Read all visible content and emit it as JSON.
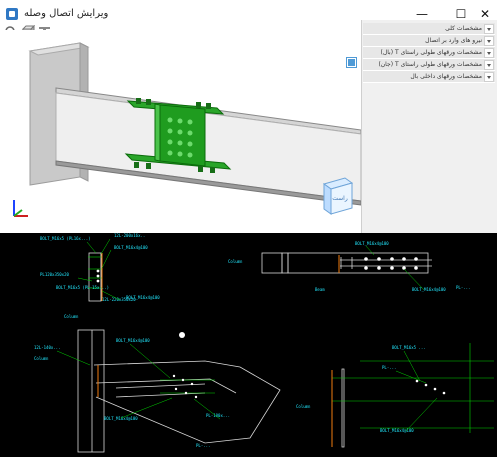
{
  "window": {
    "title": "ویرایش اتصال وصله",
    "minimize": "—",
    "maximize": "☐",
    "close": "✕"
  },
  "toolbar": {
    "zoom_icon": "magnifier-icon",
    "box_icon": "box-icon",
    "beam_icon": "beam-icon"
  },
  "right_panel": {
    "items": [
      "مشخصات کلی",
      "نیرو های وارد بر اتصال",
      "مشخصات ورقهای طولی راستای T (بال)",
      "مشخصات ورقهای طولی راستای T (جان)",
      "مشخصات ورقهای داخلی بال"
    ]
  },
  "cube": {
    "face_label": "راست"
  },
  "drawing": {
    "labels": {
      "top_left_1": "BOLT_M16x5 (PL16x...)",
      "top_left_2": "12L-200x16x..",
      "top_left_3": "BOLT_M16x4@100",
      "top_left_4": "PL120x350x20",
      "top_left_5": "BOLT_M16x5 (PL-15x...)",
      "top_left_6": "12L-220x350x20",
      "top_left_7": "BOLT_M16x4@100",
      "top_left_8": "Column",
      "top_left_9": "12L-140x...",
      "top_right_1": "Column",
      "top_right_2": "BOLT_M16x4@100",
      "top_right_3": "PL-...",
      "top_right_4": "BOLT_M16x4@100",
      "top_right_5": "Beam",
      "bottom_left_1": "Column",
      "bottom_left_2": "BOLT_M16x4@100",
      "bottom_left_3": "BOLT_M16x4@100",
      "bottom_left_4": "PL-100x...",
      "bottom_left_5": "PL-...",
      "bottom_right_1": "BOLT_M16x5 ...",
      "bottom_right_2": "PL-...",
      "bottom_right_3": "BOLT_M16x4@100",
      "bottom_right_4": "Column"
    }
  }
}
